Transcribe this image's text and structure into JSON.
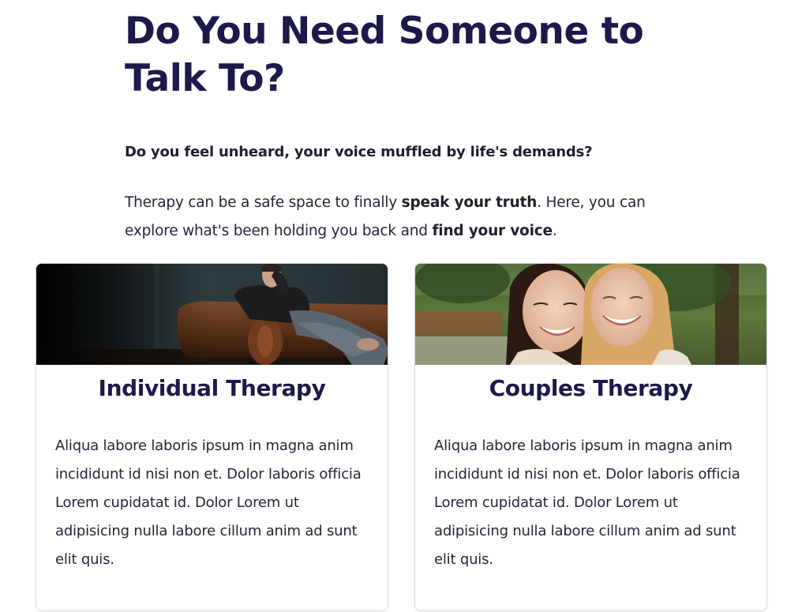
{
  "hero": {
    "title": "Do You Need Someone to Talk To?"
  },
  "intro": {
    "question": "Do you feel unheard, your voice muffled by life's demands?",
    "paragraph_part1": "Therapy can be a safe space to finally ",
    "paragraph_bold1": "speak your truth",
    "paragraph_part2": ". Here, you can explore what's been holding you back and ",
    "paragraph_bold2": "find your voice",
    "paragraph_part3": "."
  },
  "cards": [
    {
      "title": "Individual Therapy",
      "text": "Aliqua labore laboris ipsum in magna anim incididunt id nisi non et. Dolor laboris officia Lorem cupidatat id. Dolor Lorem ut adipisicing nulla labore cillum anim ad sunt elit quis.",
      "image": "person-on-couch-photo"
    },
    {
      "title": "Couples Therapy",
      "text": "Aliqua labore laboris ipsum in magna anim incididunt id nisi non et. Dolor laboris officia Lorem cupidatat id. Dolor Lorem ut adipisicing nulla labore cillum anim ad sunt elit quis.",
      "image": "two-women-smiling-photo"
    }
  ],
  "colors": {
    "heading": "#1c1a4a",
    "text": "#24243a",
    "card_border": "#d8d8de"
  }
}
